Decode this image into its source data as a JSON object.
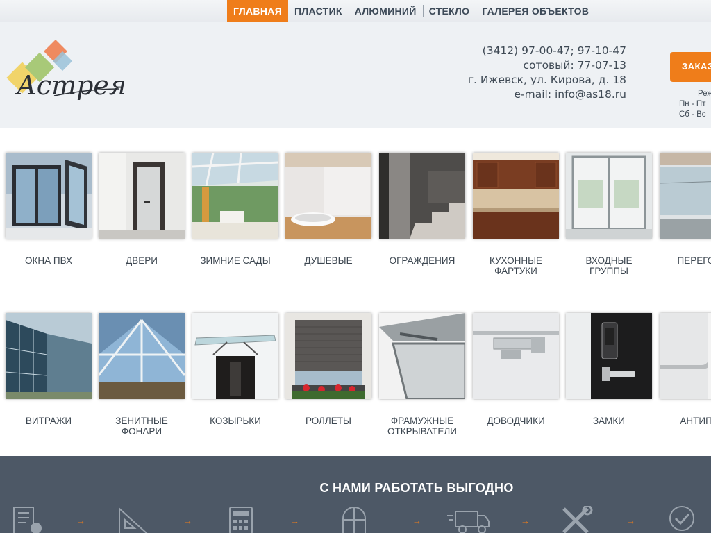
{
  "nav": {
    "items": [
      {
        "label": "ГЛАВНАЯ",
        "active": true
      },
      {
        "label": "ПЛАСТИК",
        "active": false
      },
      {
        "label": "АЛЮМИНИЙ",
        "active": false
      },
      {
        "label": "СТЕКЛО",
        "active": false
      },
      {
        "label": "ГАЛЕРЕЯ ОБЪЕКТОВ",
        "active": false
      }
    ]
  },
  "header": {
    "logo_text": "Астрея",
    "phone": "(3412) 97-00-47; 97-10-47",
    "mobile": "сотовый: 77-07-13",
    "address": "г. Ижевск, ул. Кирова, д. 18",
    "email": "e-mail: info@as18.ru",
    "order_label": "ЗАКАЗ",
    "hours": [
      "Реж",
      "Пн - Пт",
      "Сб - Вс"
    ]
  },
  "categories": [
    {
      "label": "ОКНА ПВХ",
      "icon": "pvc-window-photo"
    },
    {
      "label": "ДВЕРИ",
      "icon": "door-photo"
    },
    {
      "label": "ЗИМНИЕ САДЫ",
      "icon": "winter-garden-photo"
    },
    {
      "label": "ДУШЕВЫЕ",
      "icon": "shower-photo"
    },
    {
      "label": "ОГРАЖДЕНИЯ",
      "icon": "railing-photo"
    },
    {
      "label": "КУХОННЫЕ\nФАРТУКИ",
      "icon": "kitchen-backsplash-photo"
    },
    {
      "label": "ВХОДНЫЕ\nГРУППЫ",
      "icon": "entrance-photo"
    },
    {
      "label": "ПЕРЕГОРО",
      "icon": "partition-photo"
    },
    {
      "label": "ВИТРАЖИ",
      "icon": "stained-glass-facade-photo"
    },
    {
      "label": "ЗЕНИТНЫЕ\nФОНАРИ",
      "icon": "skylight-photo"
    },
    {
      "label": "КОЗЫРЬКИ",
      "icon": "canopy-photo"
    },
    {
      "label": "РОЛЛЕТЫ",
      "icon": "roller-shutter-photo"
    },
    {
      "label": "ФРАМУЖНЫЕ\nОТКРЫВАТЕЛИ",
      "icon": "transom-opener-photo"
    },
    {
      "label": "ДОВОДЧИКИ",
      "icon": "door-closer-photo"
    },
    {
      "label": "ЗАМКИ",
      "icon": "lock-photo"
    },
    {
      "label": "АНТИПАН",
      "icon": "panic-bar-photo"
    }
  ],
  "benefits": {
    "title": "С НАМИ РАБОТАТЬ ВЫГОДНО",
    "icons": [
      "checklist-icon",
      "ruler-triangle-icon",
      "calculator-icon",
      "window-arch-icon",
      "delivery-truck-icon",
      "tools-icon",
      "quality-badge-icon"
    ],
    "arrow": "→"
  },
  "colors": {
    "accent": "#ef7d1a",
    "band": "#4d5866",
    "header_bg": "#eef1f4"
  }
}
